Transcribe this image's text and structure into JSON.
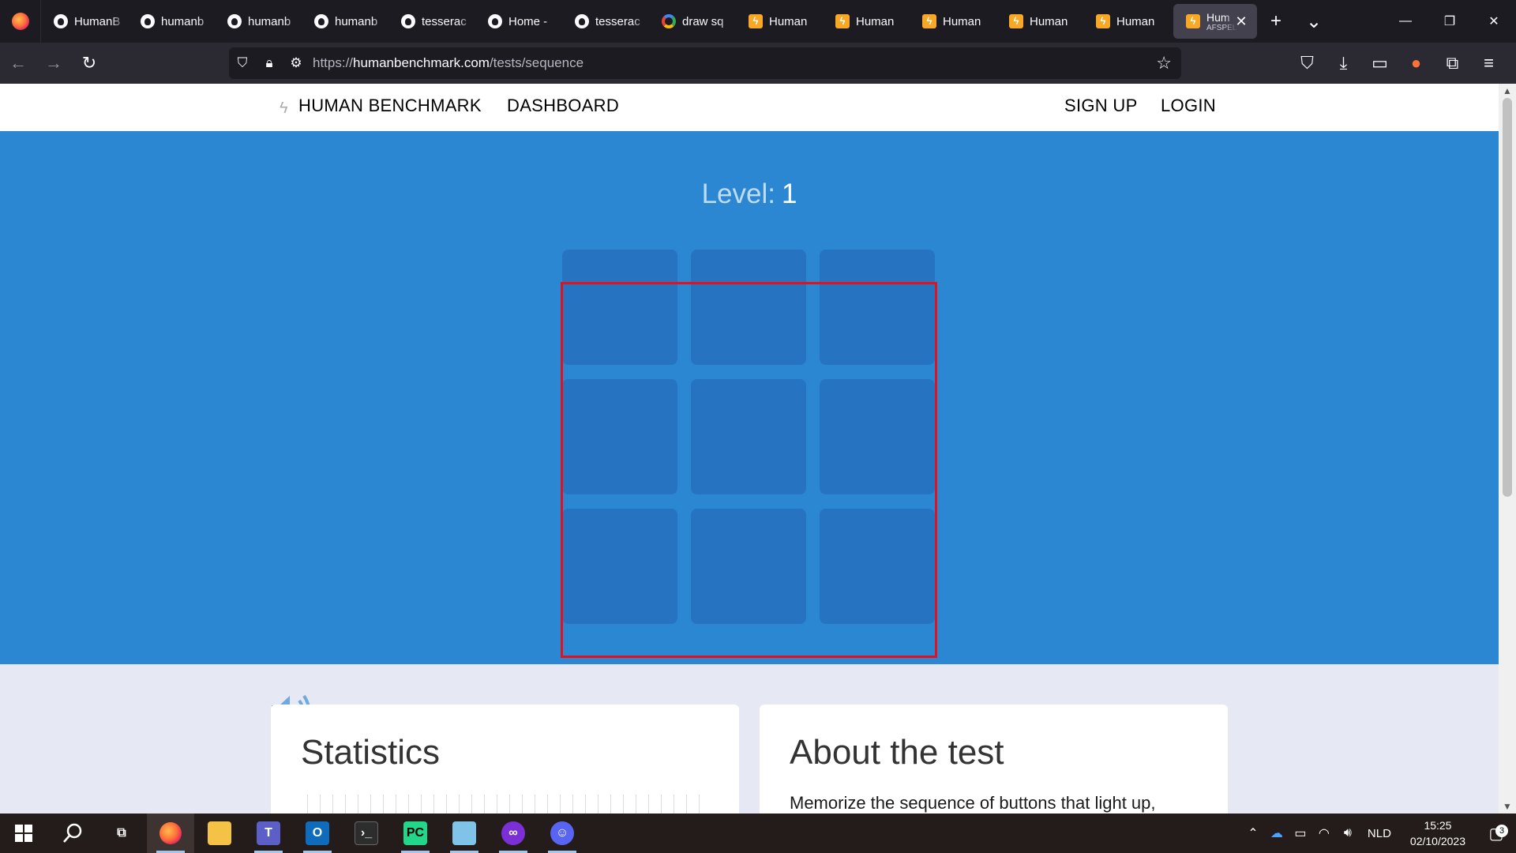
{
  "browser": {
    "tabs": [
      {
        "label": "HumanB",
        "favicon": "github-icon"
      },
      {
        "label": "humanb",
        "favicon": "github-icon"
      },
      {
        "label": "humanb",
        "favicon": "github-icon"
      },
      {
        "label": "humanb",
        "favicon": "github-icon"
      },
      {
        "label": "tesserac",
        "favicon": "github-icon"
      },
      {
        "label": "Home - ",
        "favicon": "github-icon"
      },
      {
        "label": "tesserac",
        "favicon": "github-icon"
      },
      {
        "label": "draw sq",
        "favicon": "google-icon"
      },
      {
        "label": "Human ",
        "favicon": "humanbenchmark-icon"
      },
      {
        "label": "Human ",
        "favicon": "humanbenchmark-icon"
      },
      {
        "label": "Human ",
        "favicon": "humanbenchmark-icon"
      },
      {
        "label": "Human ",
        "favicon": "humanbenchmark-icon"
      },
      {
        "label": "Human ",
        "favicon": "humanbenchmark-icon"
      }
    ],
    "active_tab": {
      "label": "Hum",
      "sublabel": "AFSPEL",
      "favicon": "humanbenchmark-icon"
    },
    "url": {
      "prefix": "https://",
      "host": "humanbenchmark.com",
      "path": "/tests/sequence"
    }
  },
  "site": {
    "nav": {
      "brand": "HUMAN BENCHMARK",
      "dashboard": "DASHBOARD",
      "signup": "SIGN UP",
      "login": "LOGIN"
    },
    "level_label": "Level:",
    "level_value": "1",
    "grid": {
      "rows": 3,
      "cols": 3,
      "square_color": "#2573c1",
      "background": "#2b87d1",
      "highlight_outline": "#e6101a"
    },
    "cards": {
      "statistics_title": "Statistics",
      "about_title": "About the test",
      "about_text": "Memorize the sequence of buttons that light up,"
    }
  },
  "taskbar": {
    "apps": [
      "windows-start-icon",
      "search-icon",
      "task-view-icon",
      "firefox-icon",
      "file-explorer-icon",
      "teams-icon",
      "outlook-icon",
      "terminal-icon",
      "pycharm-icon",
      "notepad-icon",
      "incognito-app-icon",
      "discord-app-icon"
    ],
    "language": "NLD",
    "time": "15:25",
    "date": "02/10/2023",
    "notifications": "3"
  }
}
